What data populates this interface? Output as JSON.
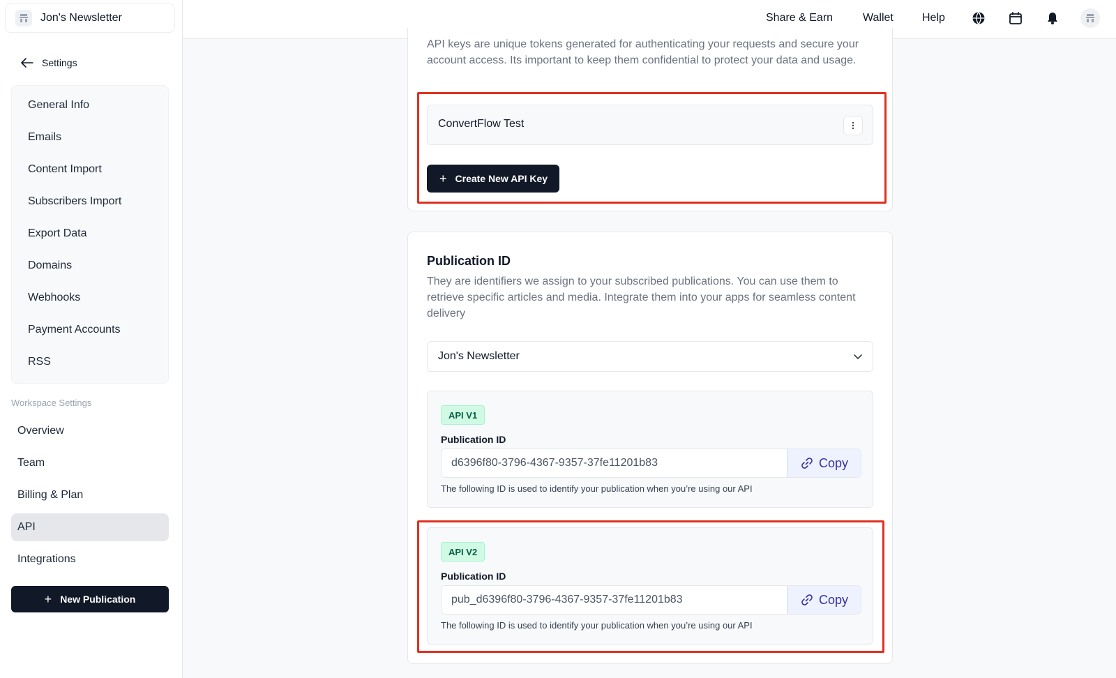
{
  "sidebar": {
    "publication_name": "Jon's Newsletter",
    "back_label": "Settings",
    "settings_items": [
      "General Info",
      "Emails",
      "Content Import",
      "Subscribers Import",
      "Export Data",
      "Domains",
      "Webhooks",
      "Payment Accounts",
      "RSS"
    ],
    "workspace_label": "Workspace Settings",
    "workspace_items": [
      "Overview",
      "Team",
      "Billing & Plan",
      "API",
      "Integrations"
    ],
    "active_item": "API",
    "new_publication_label": "New Publication"
  },
  "topbar": {
    "links": [
      "Share & Earn",
      "Wallet",
      "Help"
    ],
    "icons": [
      "globe-icon",
      "calendar-icon",
      "bell-icon",
      "avatar"
    ]
  },
  "api_keys": {
    "description": "API keys are unique tokens generated for authenticating your requests and secure your account access. Its important to keep them confidential to protect your data and usage.",
    "keys": [
      {
        "name": "ConvertFlow Test"
      }
    ],
    "create_label": "Create New API Key"
  },
  "publication_id": {
    "title": "Publication ID",
    "description": "They are identifiers we assign to your subscribed publications. You can use them to retrieve specific articles and media. Integrate them into your apps for seamless content delivery",
    "selected_publication": "Jon's Newsletter",
    "v1": {
      "badge": "API V1",
      "label": "Publication ID",
      "value": "d6396f80-3796-4367-9357-37fe11201b83",
      "copy_label": "Copy",
      "hint": "The following ID is used to identify your publication when you’re using our API"
    },
    "v2": {
      "badge": "API V2",
      "label": "Publication ID",
      "value": "pub_d6396f80-3796-4367-9357-37fe11201b83",
      "copy_label": "Copy",
      "hint": "The following ID is used to identify your publication when you’re using our API"
    }
  },
  "colors": {
    "highlight": "#e0301e",
    "dark_button": "#111827",
    "badge_bg": "#d1fae5",
    "copy_bg": "#eef2ff"
  }
}
